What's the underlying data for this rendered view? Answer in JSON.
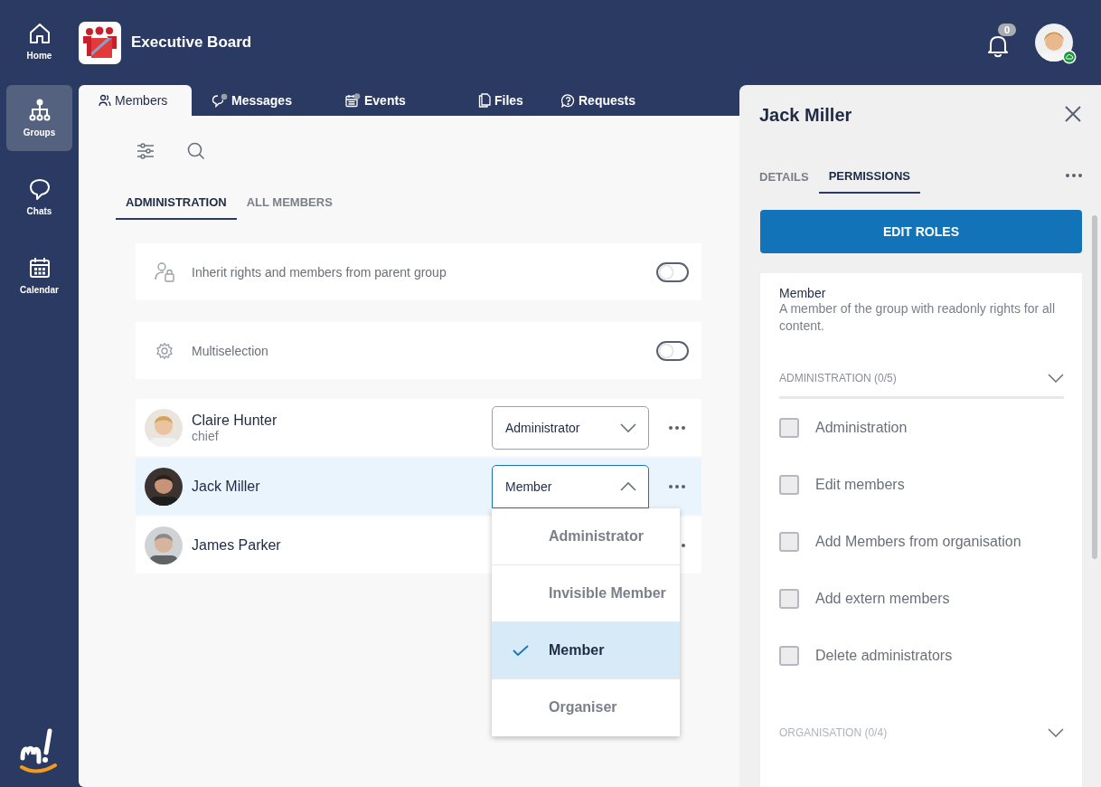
{
  "nav": [
    {
      "label": "Home",
      "selected": false
    },
    {
      "label": "Groups",
      "selected": true
    },
    {
      "label": "Chats",
      "selected": false
    },
    {
      "label": "Calendar",
      "selected": false
    }
  ],
  "header": {
    "title": "Executive Board",
    "notification_count": "0"
  },
  "tabs": [
    {
      "label": "Members",
      "selected": true
    },
    {
      "label": "Messages",
      "selected": false
    },
    {
      "label": "Events",
      "selected": false
    },
    {
      "label": "Files",
      "selected": false
    },
    {
      "label": "Requests",
      "selected": false
    }
  ],
  "views": [
    {
      "label": "ADMINISTRATION",
      "selected": true
    },
    {
      "label": "ALL MEMBERS",
      "selected": false
    }
  ],
  "settings": [
    {
      "label": "Inherit rights and members from parent group",
      "on": false
    },
    {
      "label": "Multiselection",
      "on": false
    }
  ],
  "members": [
    {
      "name": "Claire Hunter",
      "subtitle": "chief",
      "role": "Administrator",
      "selected": false,
      "open": false
    },
    {
      "name": "Jack Miller",
      "role": "Member",
      "selected": true,
      "open": true
    },
    {
      "name": "James Parker",
      "selected": false,
      "open": false
    }
  ],
  "role_menu": [
    {
      "label": "Administrator",
      "selected": false
    },
    {
      "label": "Invisible Member",
      "selected": false
    },
    {
      "label": "Member",
      "selected": true
    },
    {
      "label": "Organiser",
      "selected": false
    }
  ],
  "panel": {
    "title": "Jack Miller",
    "tabs": [
      {
        "label": "DETAILS",
        "selected": false
      },
      {
        "label": "PERMISSIONS",
        "selected": true
      }
    ],
    "button": "EDIT ROLES",
    "role": {
      "name": "Member",
      "description": "A member of the group with readonly rights for all content."
    },
    "sections": [
      {
        "title": "ADMINISTRATION (0/5)",
        "permissions": [
          {
            "label": "Administration",
            "checked": false
          },
          {
            "label": "Edit members",
            "checked": false
          },
          {
            "label": "Add Members from organisation",
            "checked": false
          },
          {
            "label": "Add extern members",
            "checked": false
          },
          {
            "label": "Delete administrators",
            "checked": false
          }
        ]
      },
      {
        "title": "ORGANISATION (0/4)"
      }
    ]
  }
}
